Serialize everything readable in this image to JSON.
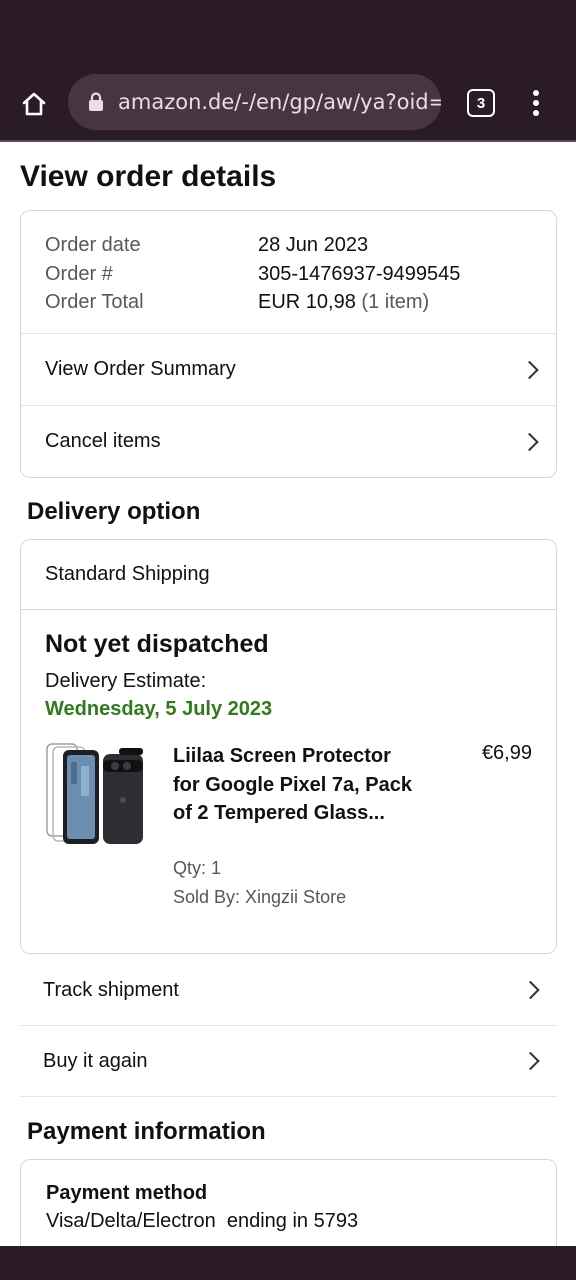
{
  "browser": {
    "url": "amazon.de/-/en/gp/aw/ya?oid=",
    "tab_count": "3"
  },
  "page": {
    "title": "View order details"
  },
  "order": {
    "date_label": "Order date",
    "date_value": "28 Jun 2023",
    "number_label": "Order #",
    "number_value": "305-1476937-9499545",
    "total_label": "Order Total",
    "total_value": "EUR 10,98",
    "total_items": "(1 item)",
    "summary_link": "View Order Summary",
    "cancel_link": "Cancel items"
  },
  "delivery": {
    "section_title": "Delivery option",
    "shipping_method": "Standard Shipping",
    "status": "Not yet dispatched",
    "estimate_label": "Delivery Estimate:",
    "estimate_date": "Wednesday, 5 July 2023",
    "estimate_color": "#2e7d1a",
    "product": {
      "title": "Liilaa Screen Protector for Google Pixel 7a, Pack of 2 Tempered Glass...",
      "price": "€6,99",
      "qty": "Qty: 1",
      "seller": "Sold By: Xingzii Store"
    },
    "track_link": "Track shipment",
    "buy_again_link": "Buy it again"
  },
  "payment": {
    "section_title": "Payment information",
    "method_label": "Payment method",
    "method_value": "Visa/Delta/Electron  ending in 5793"
  }
}
